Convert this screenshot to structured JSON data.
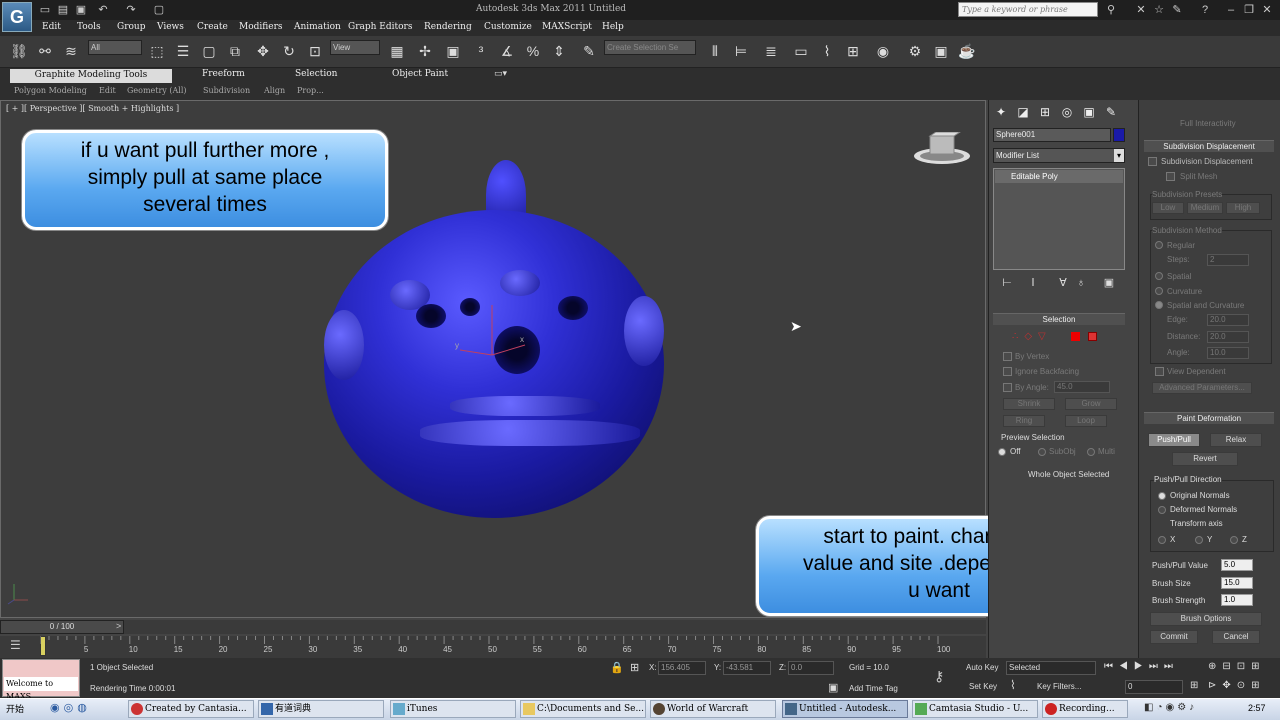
{
  "titlebar": {
    "title": "Autodesk 3ds Max  2011       Untitled",
    "search_placeholder": "Type a keyword or phrase",
    "clock_small": "2:57"
  },
  "menu": {
    "items": [
      "Edit",
      "Tools",
      "Group",
      "Views",
      "Create",
      "Modifiers",
      "Animation",
      "Graph Editors",
      "Rendering",
      "Customize",
      "MAXScript",
      "Help"
    ]
  },
  "toolbar": {
    "filter_select": "All",
    "view_select": "View",
    "selection_set_placeholder": "Create Selection Se"
  },
  "ribbon": {
    "tabs": [
      "Graphite Modeling Tools",
      "Freeform",
      "Selection",
      "Object Paint"
    ],
    "subtabs": [
      "Polygon Modeling",
      "Edit",
      "Geometry (All)",
      "Subdivision",
      "Align",
      "Prop..."
    ]
  },
  "viewport": {
    "label": "[ + ][ Perspective ][ Smooth + Highlights ]"
  },
  "callouts": {
    "first": [
      "if u want pull further more ,",
      "simply pull at same place",
      "several times"
    ],
    "second": [
      "start to paint. change the",
      "value and site .depends what",
      "u want"
    ]
  },
  "timeline": {
    "slider": "0 / 100",
    "ticks": [
      "0",
      "5",
      "10",
      "15",
      "20",
      "25",
      "30",
      "35",
      "40",
      "45",
      "50",
      "55",
      "60",
      "65",
      "70",
      "75",
      "80",
      "85",
      "90",
      "95",
      "100"
    ]
  },
  "status": {
    "maxscript_line1": "",
    "maxscript_line2": "Welcome to MAXS",
    "selected": "1 Object Selected",
    "rendering_time": "Rendering Time  0:00:01",
    "x_label": "X:",
    "x_value": "156.405",
    "y_label": "Y:",
    "y_value": "-43.581",
    "z_label": "Z:",
    "z_value": "0.0",
    "grid": "Grid = 10.0",
    "add_time_tag": "Add Time Tag",
    "auto_key": "Auto Key",
    "set_key": "Set Key",
    "selected_dropdown": "Selected",
    "key_filters": "Key Filters...",
    "frame_value": "0"
  },
  "command_panel": {
    "object_name": "Sphere001",
    "object_color": "#1a1aa8",
    "modifier_list": "Modifier List",
    "stack_item": "Editable Poly",
    "selection_title": "Selection",
    "by_vertex": "By Vertex",
    "ignore_backfacing": "Ignore Backfacing",
    "by_angle": "By Angle:",
    "by_angle_value": "45.0",
    "shrink": "Shrink",
    "grow": "Grow",
    "ring": "Ring",
    "loop": "Loop",
    "preview_selection": "Preview Selection",
    "off": "Off",
    "subobj": "SubObj",
    "multi": "Multi",
    "whole_object": "Whole Object Selected"
  },
  "graphite_panel": {
    "top_clip": "Full Interactivity",
    "subdiv_title": "Subdivision Displacement",
    "subdiv_check": "Subdivision Displacement",
    "split_mesh": "Split Mesh",
    "presets_label": "Subdivision Presets",
    "low": "Low",
    "medium": "Medium",
    "high": "High",
    "method_label": "Subdivision Method",
    "regular": "Regular",
    "steps": "Steps:",
    "steps_value": "2",
    "spatial": "Spatial",
    "curvature": "Curvature",
    "spatial_curv": "Spatial and Curvature",
    "edge": "Edge:",
    "edge_value": "20.0",
    "distance": "Distance:",
    "distance_value": "20.0",
    "angle": "Angle:",
    "angle_value": "10.0",
    "view_dependent": "View Dependent",
    "advanced": "Advanced Parameters...",
    "paint_title": "Paint Deformation",
    "push_pull": "Push/Pull",
    "relax": "Relax",
    "revert": "Revert",
    "direction_label": "Push/Pull Direction",
    "original_normals": "Original Normals",
    "deformed_normals": "Deformed Normals",
    "transform_axis": "Transform axis",
    "ax": "X",
    "ay": "Y",
    "az": "Z",
    "pp_value_label": "Push/Pull Value",
    "pp_value": "5.0",
    "brush_size_label": "Brush Size",
    "brush_size": "15.0",
    "brush_strength_label": "Brush Strength",
    "brush_strength": "1.0",
    "brush_options": "Brush Options",
    "commit": "Commit",
    "cancel": "Cancel"
  },
  "taskbar": {
    "start": "开始",
    "items": [
      "Created by Cantasia...",
      "有道词典",
      "iTunes",
      "C:\\Documents and Se...",
      "World of Warcraft",
      "Untitled - Autodesk...",
      "Camtasia Studio - U...",
      "Recording..."
    ],
    "clock": "2:57"
  }
}
